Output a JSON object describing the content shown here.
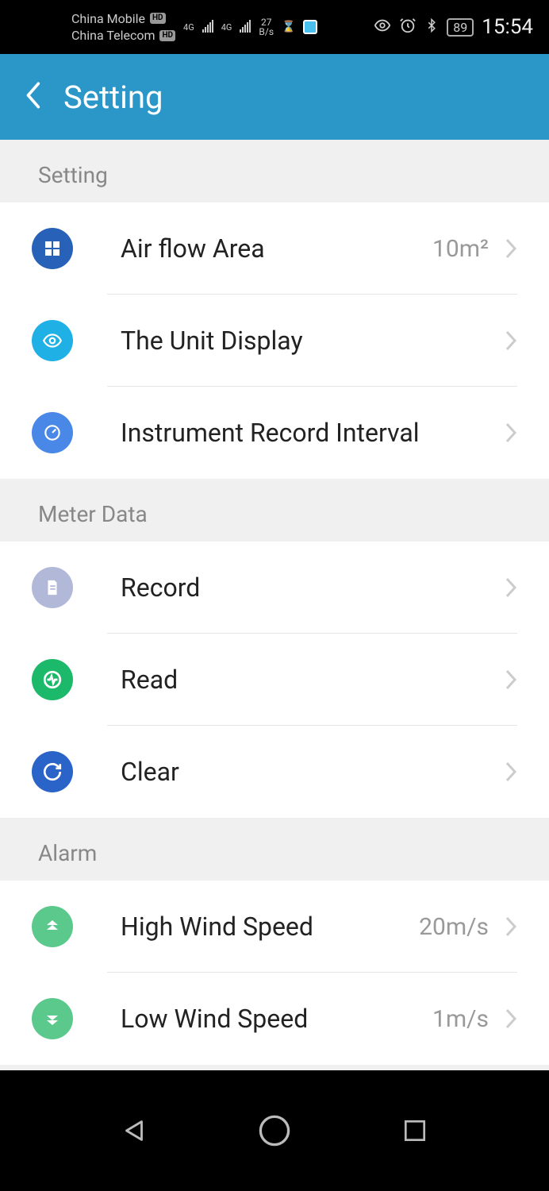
{
  "status_bar": {
    "carrier1": "China Mobile",
    "carrier2": "China Telecom",
    "hd": "HD",
    "net_label": "4G",
    "data_rate_top": "27",
    "data_rate_bottom": "B/s",
    "battery": "89",
    "time": "15:54"
  },
  "header": {
    "title": "Setting"
  },
  "sections": {
    "setting": {
      "title": "Setting",
      "air_flow_area": {
        "label": "Air flow Area",
        "value": "10m²"
      },
      "unit_display": {
        "label": "The Unit Display"
      },
      "record_interval": {
        "label": "Instrument Record Interval"
      }
    },
    "meter_data": {
      "title": "Meter Data",
      "record": {
        "label": "Record"
      },
      "read": {
        "label": "Read"
      },
      "clear": {
        "label": "Clear"
      }
    },
    "alarm": {
      "title": "Alarm",
      "high_wind": {
        "label": "High Wind Speed",
        "value": "20m/s"
      },
      "low_wind": {
        "label": "Low Wind Speed",
        "value": "1m/s"
      }
    }
  },
  "icons": {
    "grid": "#2862b8",
    "eye": "#1fb1e6",
    "gauge": "#4a88e8",
    "doc": "#b2b8d8",
    "pulse": "#1db96a",
    "sync": "#2a64c8",
    "arrow_up": "#5cc98c",
    "arrow_down": "#5cc98c"
  }
}
